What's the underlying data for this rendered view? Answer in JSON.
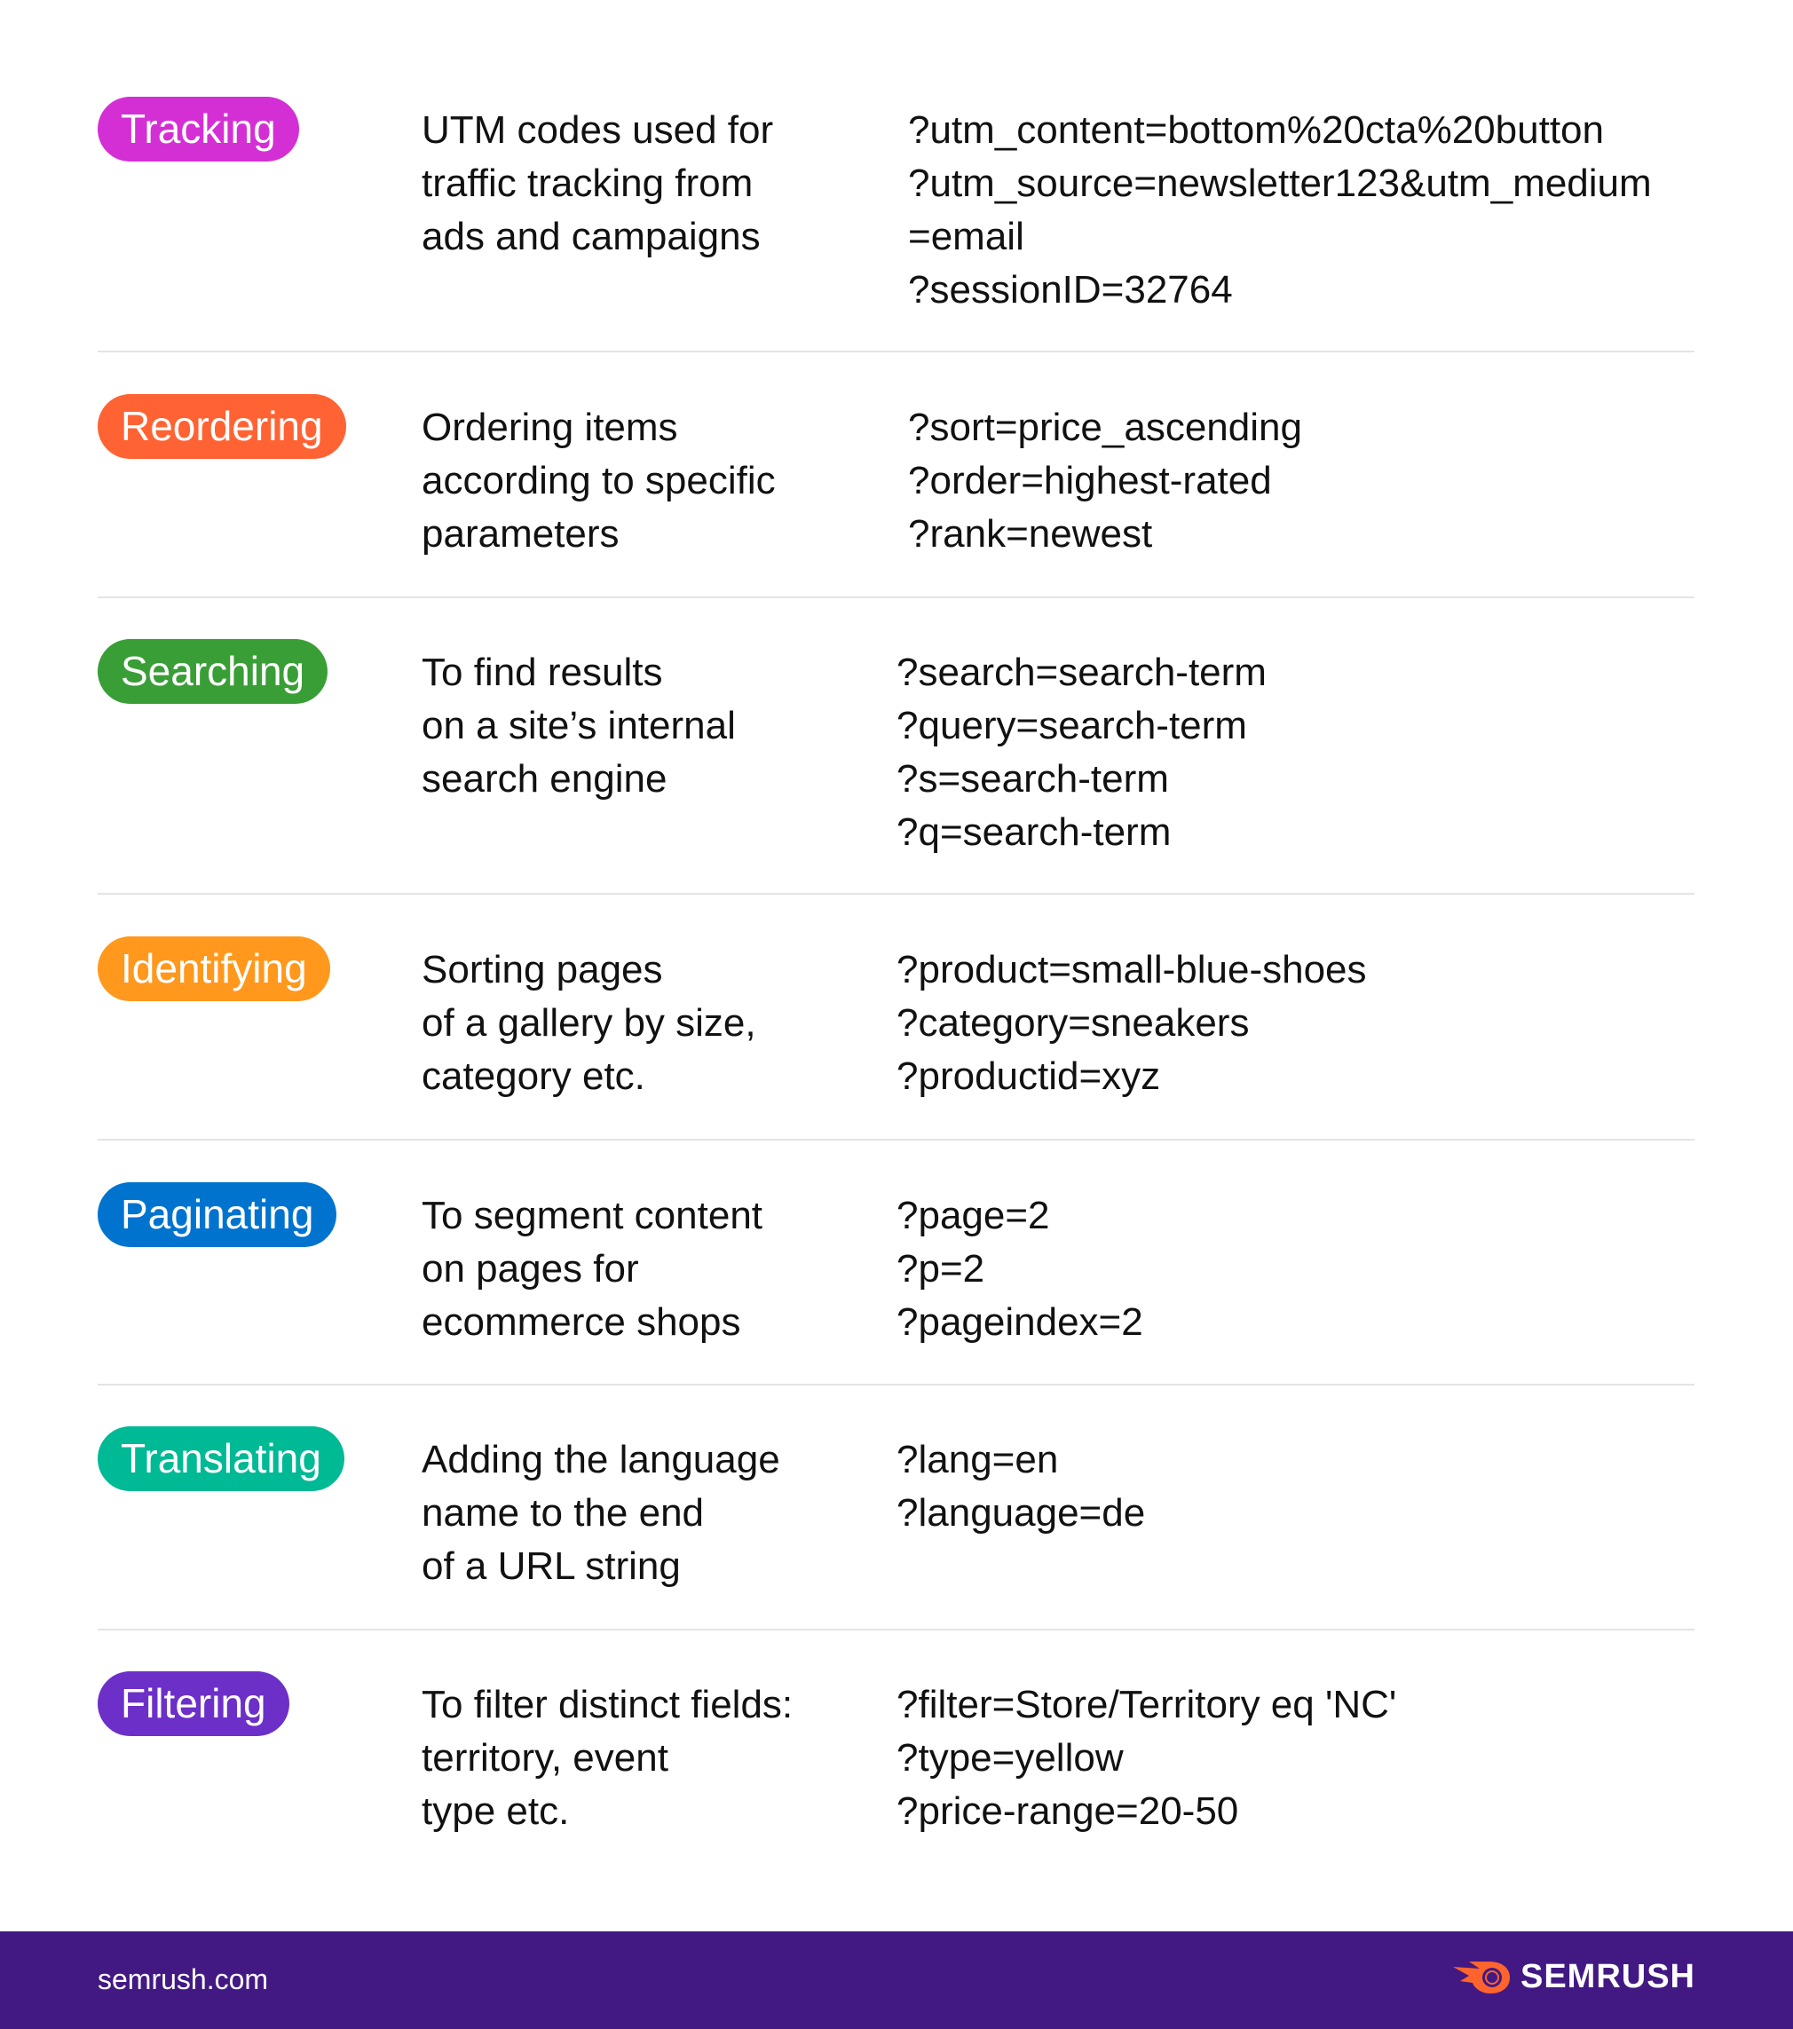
{
  "rows": [
    {
      "tag": "Tracking",
      "color": "#d42fd4",
      "description": [
        "UTM codes used for",
        "traffic tracking from",
        "ads and campaigns"
      ],
      "examples": [
        "?utm_content=bottom%20cta%20button",
        "?utm_source=newsletter123&utm_medium",
        "=email",
        "?sessionID=32764"
      ]
    },
    {
      "tag": "Reordering",
      "color": "#ff6333",
      "description": [
        "Ordering items",
        "according to specific",
        "parameters"
      ],
      "examples": [
        "?sort=price_ascending",
        "?order=highest-rated",
        "?rank=newest"
      ]
    },
    {
      "tag": "Searching",
      "color": "#3a9e37",
      "description": [
        "To find results",
        "on a site’s internal",
        "search engine"
      ],
      "examples": [
        "?search=search-term",
        "?query=search-term",
        "?s=search-term",
        "?q=search-term"
      ]
    },
    {
      "tag": "Identifying",
      "color": "#ff981c",
      "description": [
        "Sorting pages",
        "of a gallery by size,",
        "category etc."
      ],
      "examples": [
        "?product=small-blue-shoes",
        "?category=sneakers",
        "?productid=xyz"
      ]
    },
    {
      "tag": "Paginating",
      "color": "#0073cf",
      "description": [
        "To segment content",
        "on pages for",
        "ecommerce shops"
      ],
      "examples": [
        "?page=2",
        "?p=2",
        "?pageindex=2"
      ]
    },
    {
      "tag": "Translating",
      "color": "#00b995",
      "description": [
        "Adding the language",
        "name to the end",
        "of a URL string"
      ],
      "examples": [
        "?lang=en",
        "?language=de"
      ]
    },
    {
      "tag": "Filtering",
      "color": "#6c2fc8",
      "description": [
        "To filter distinct fields:",
        "territory, event",
        "type etc."
      ],
      "examples": [
        "?filter=Store/Territory eq 'NC'",
        "?type=yellow",
        "?price-range=20-50"
      ]
    }
  ],
  "footer": {
    "site": "semrush.com",
    "brand": "SEMRUSH",
    "background": "#421983",
    "logo_icon": "semrush-fireball-icon",
    "logo_color": "#ff642d"
  }
}
